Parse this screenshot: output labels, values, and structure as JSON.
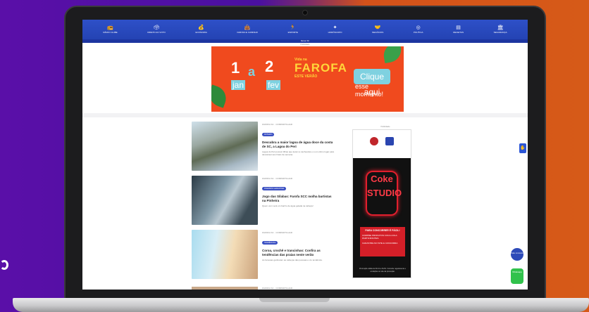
{
  "nav": {
    "items": [
      {
        "label": "Rádio Clube",
        "icon": "radio-icon"
      },
      {
        "label": "Direto ao Voto",
        "icon": "ballot-icon"
      },
      {
        "label": "Economia",
        "icon": "coins-icon"
      },
      {
        "label": "Farofa e Caminho",
        "icon": "bag-icon"
      },
      {
        "label": "Esporte",
        "icon": "runner-icon"
      },
      {
        "label": "Horóscopo",
        "icon": "star-icon"
      },
      {
        "label": "Negócios",
        "icon": "handshake-icon"
      },
      {
        "label": "Política",
        "icon": "globe-icon"
      },
      {
        "label": "Receitas",
        "icon": "recipe-icon"
      },
      {
        "label": "Segurança",
        "icon": "building-icon"
      }
    ]
  },
  "subbar": {
    "label": "Ramon SC"
  },
  "ads": {
    "label": "Publicidade"
  },
  "banner": {
    "date_start_day": "1",
    "date_start_month": "jan",
    "connector": "a",
    "date_end_day": "2",
    "date_end_month": "fev",
    "brand_top": "Vida na",
    "brand": "FAROFA",
    "brand_sub": "ESTE VERÃO",
    "cta": "Clique aqui",
    "cta_sub": "esse momento!"
  },
  "posts": [
    {
      "meta": "FAROFA SC · COMPARTILHAR",
      "tag": "Roteiro",
      "title": "Descubra a maior lagoa de água doce da costa de SC, a Lagoa do Peri",
      "excerpt": "Lagoa do Peri possui trilhas que levam a cachoeiras e é um ótimo lugar para descansar aos finais de semana."
    },
    {
      "meta": "FAROFA SC · COMPARTILHAR",
      "tag": "Diversão garantida",
      "title": "Jogo das Sílabas: Farofa SCC molha bartistas na Pinheira",
      "excerpt": "Quem vem verá um banho de água gelada na cabeça!"
    },
    {
      "meta": "FAROFA SC · COMPARTILHAR",
      "tag": "Tendências",
      "title": "Coroa, crochê e trancinhas: Confira as tendências das praias neste verão",
      "excerpt": "As famosas ganharam as cabeças das pessoas e viu tendência."
    }
  ],
  "next_post": {
    "meta": "FAROFA SC · COMPARTILHAR"
  },
  "side_ad": {
    "neon_text": "Coke STUDIO",
    "promo_title": "PARA CONCORRER É FÁCIL!",
    "promo_line1": "COMPRE PRODUTOS COCA-COLA PARTICIPANTES",
    "promo_line2": "CADASTRE NO SITE E CONCORRA",
    "footer": "Promoção válida de 01/12 a 31/01. Consulte regulamento e condições no site da promoção."
  },
  "floating": {
    "edge_icon": "hand-icon",
    "chat_label": "Fale conosco",
    "whatsapp_label": "Whatsapp"
  }
}
